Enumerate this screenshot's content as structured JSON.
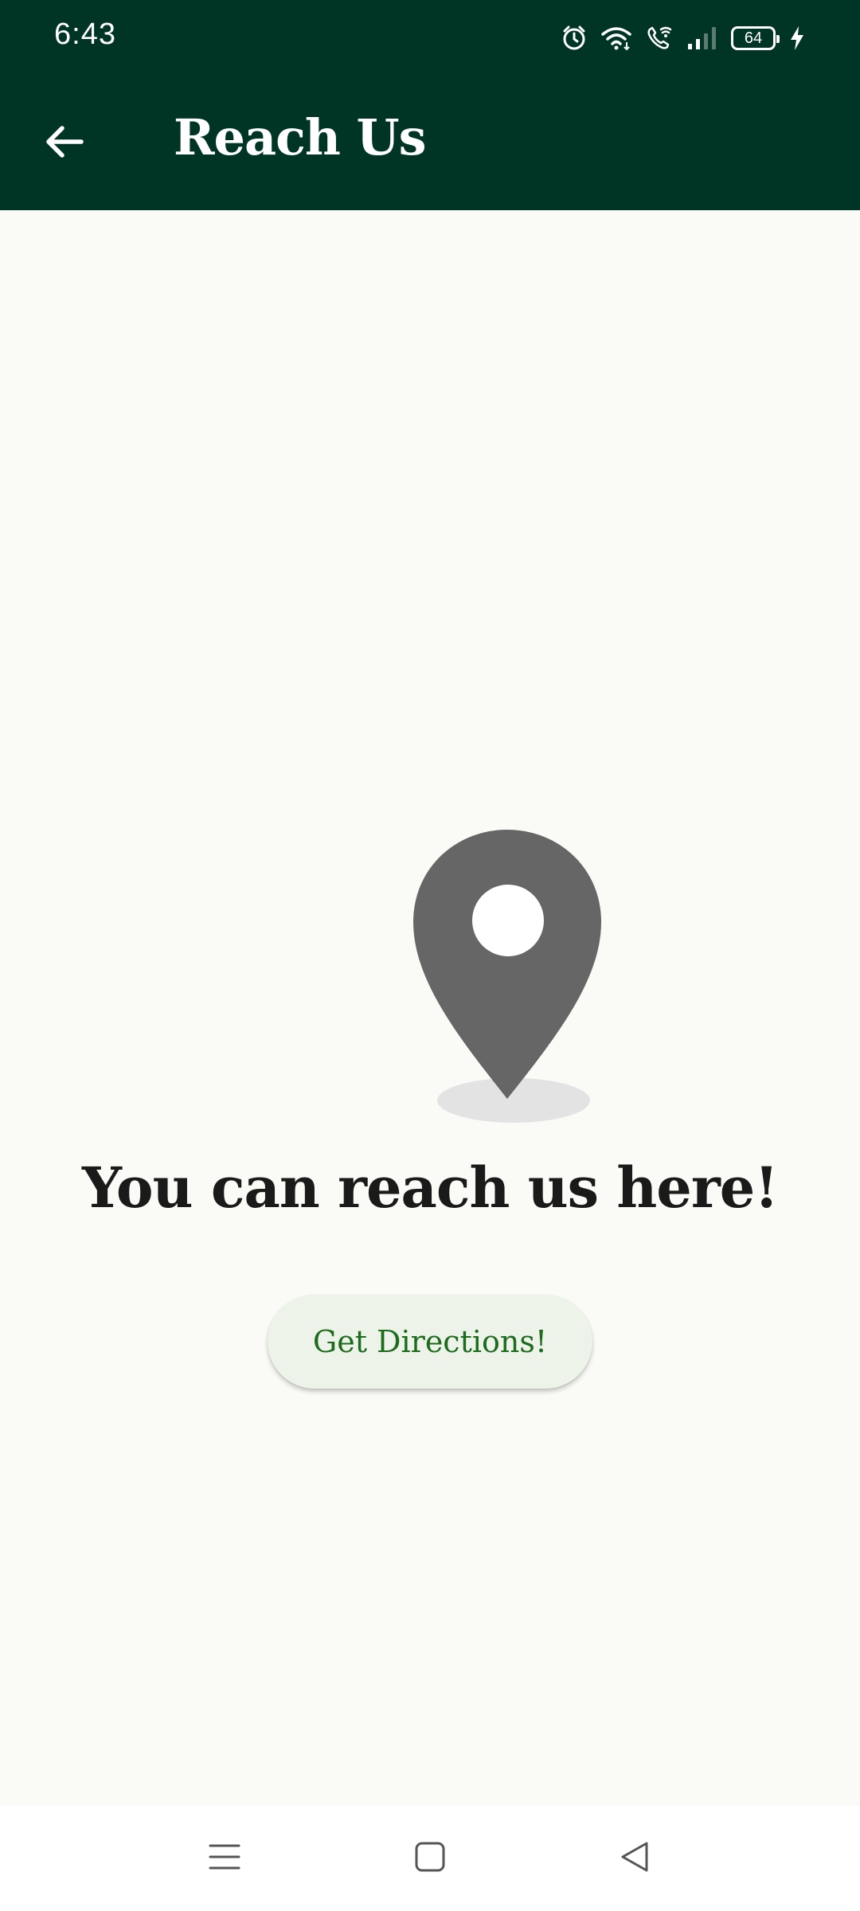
{
  "status_bar": {
    "time": "6:43",
    "battery_level": "64",
    "icons": [
      "alarm-icon",
      "wifi-icon",
      "wifi-call-icon",
      "signal-icon",
      "battery-icon",
      "charging-icon"
    ]
  },
  "app_bar": {
    "title": "Reach Us",
    "back_icon": "arrow-back-icon"
  },
  "main": {
    "illustration": "location-pin-icon",
    "message": "You can reach us here!",
    "directions_button_label": "Get Directions!"
  },
  "nav_bar": {
    "icons": [
      "menu-icon",
      "home-square-icon",
      "back-triangle-icon"
    ]
  },
  "colors": {
    "app_bar_background": "#003526",
    "page_background": "#fafaf6",
    "button_background": "#eef3ea",
    "button_text": "#1d6b1d",
    "pin_color": "#666666"
  }
}
